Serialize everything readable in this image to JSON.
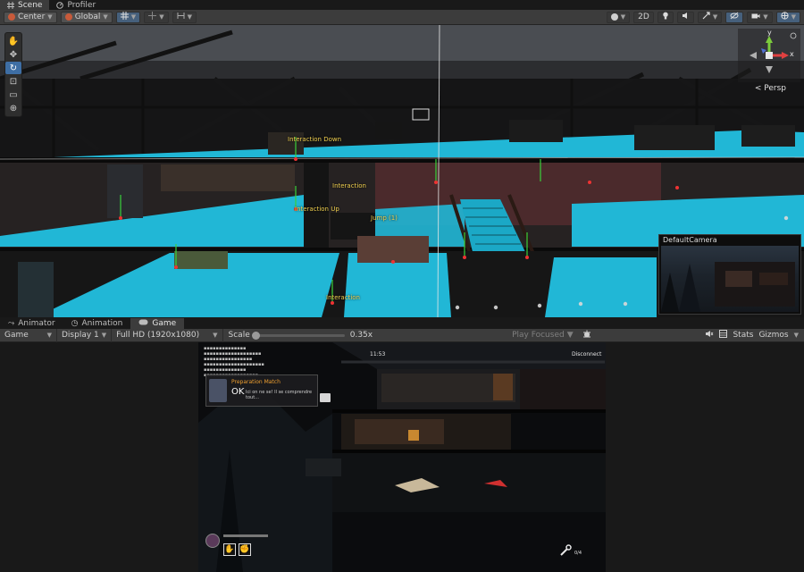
{
  "window_tabs": [
    {
      "label": "Scene",
      "icon": "hash-icon",
      "active": true
    },
    {
      "label": "Profiler",
      "icon": "profiler-icon",
      "active": false
    }
  ],
  "scene_toolbar": {
    "pivot": "Center",
    "space": "Global",
    "mode_2d": "2D"
  },
  "scene": {
    "persp_label": "Persp",
    "gizmo_axes": {
      "y": "y",
      "x": "x"
    },
    "labels": [
      {
        "text": "Interaction Down"
      },
      {
        "text": "Interaction"
      },
      {
        "text": "Interaction Up"
      },
      {
        "text": "Jump (1)"
      },
      {
        "text": "Interaction"
      }
    ],
    "camera_preview_title": "DefaultCamera"
  },
  "bottom_tabs": [
    {
      "label": "Animator",
      "active": false
    },
    {
      "label": "Animation",
      "active": false
    },
    {
      "label": "Game",
      "active": true
    }
  ],
  "game_toolbar": {
    "mode": "Game",
    "display": "Display 1",
    "resolution": "Full HD (1920x1080)",
    "scale_label": "Scale",
    "scale_value": "0.35x",
    "play_focused": "Play Focused",
    "stats": "Stats",
    "gizmos": "Gizmos"
  },
  "game_view": {
    "timer": "11:53",
    "disconnect": "Disconnect",
    "notice_title": "Preparation Match",
    "notice_ok": "OK",
    "notice_message": "Ici on ne se! Il se comprendre tout...",
    "counter": "0/4"
  },
  "colors": {
    "floor": "#21b7d6",
    "editor_bg": "#191919",
    "toolbar_bg": "#3c3c3c",
    "label_yellow": "#f0d050",
    "selection_blue": "#3e6ea4"
  }
}
